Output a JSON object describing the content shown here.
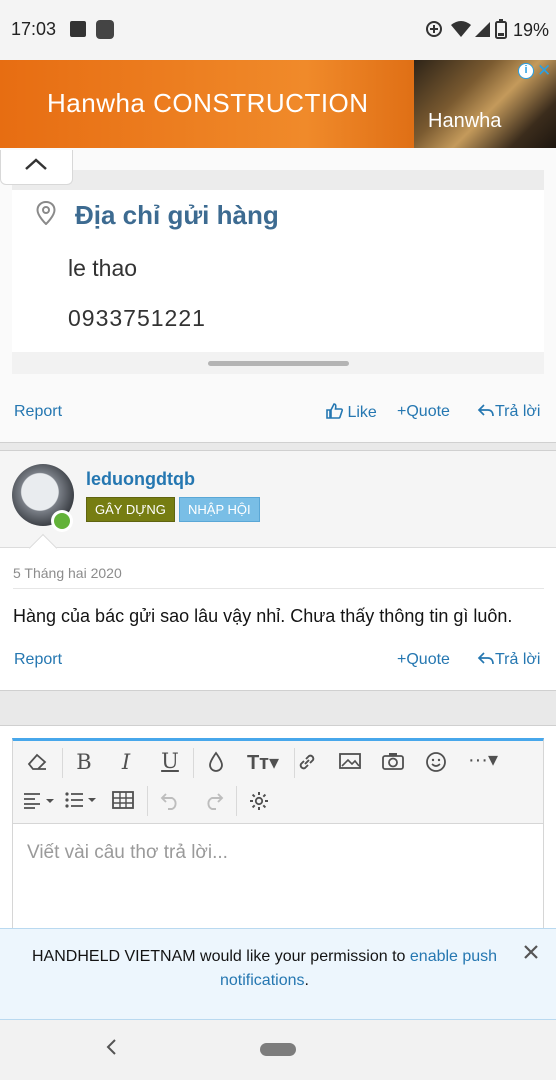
{
  "status_bar": {
    "time": "17:03",
    "battery": "19%"
  },
  "ad": {
    "brand": "Hanwha CONSTRUCTION",
    "logo": "Hanwha",
    "info_label": "i",
    "close_label": "✕"
  },
  "post1": {
    "address_card": {
      "title": "Địa chỉ gửi hàng",
      "name": "le thao",
      "phone": "0933751221"
    },
    "actions": {
      "report": "Report",
      "like": "Like",
      "quote": "Quote",
      "reply": "Trả lời"
    }
  },
  "post2": {
    "username": "leduongdtqb",
    "badges": [
      "GÂY DỰNG",
      "NHẬP HỘI"
    ],
    "date": "5 Tháng hai 2020",
    "text": "Hàng của bác gửi sao lâu vậy nhỉ. Chưa thấy thông tin gì luôn.",
    "actions": {
      "report": "Report",
      "quote": "Quote",
      "reply": "Trả lời"
    }
  },
  "editor": {
    "placeholder": "Viết vài câu thơ trả lời...",
    "tools": [
      "eraser-icon",
      "bold-icon",
      "italic-icon",
      "underline-icon",
      "color-drop-icon",
      "font-size-icon",
      "link-icon",
      "image-icon",
      "camera-icon",
      "smiley-icon",
      "more-icon",
      "align-icon",
      "list-icon",
      "table-icon",
      "undo-icon",
      "redo-icon",
      "settings-icon"
    ]
  },
  "push_notice": {
    "text_before": "HANDHELD VIETNAM would like your permission to ",
    "link": "enable push",
    "link2": "notifications",
    "text_after": "."
  }
}
